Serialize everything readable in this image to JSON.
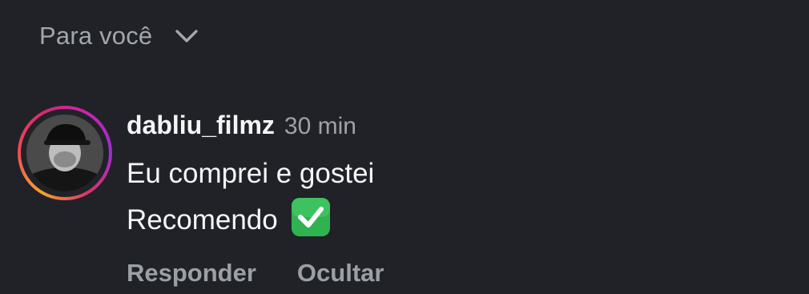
{
  "header": {
    "sort_label": "Para você",
    "chevron_icon": "chevron-down-icon"
  },
  "comment": {
    "avatar_icon": "avatar",
    "username": "dabliu_filmz",
    "timestamp": "30 min",
    "line1": "Eu comprei e gostei",
    "line2": "Recomendo",
    "emoji_icon": "check-mark-emoji-icon",
    "actions": {
      "reply": "Responder",
      "hide": "Ocultar"
    }
  },
  "colors": {
    "background": "#202227",
    "primary_text": "#f4f5f7",
    "secondary_text": "#9ea2a9",
    "emoji_green": "#2fb350"
  }
}
